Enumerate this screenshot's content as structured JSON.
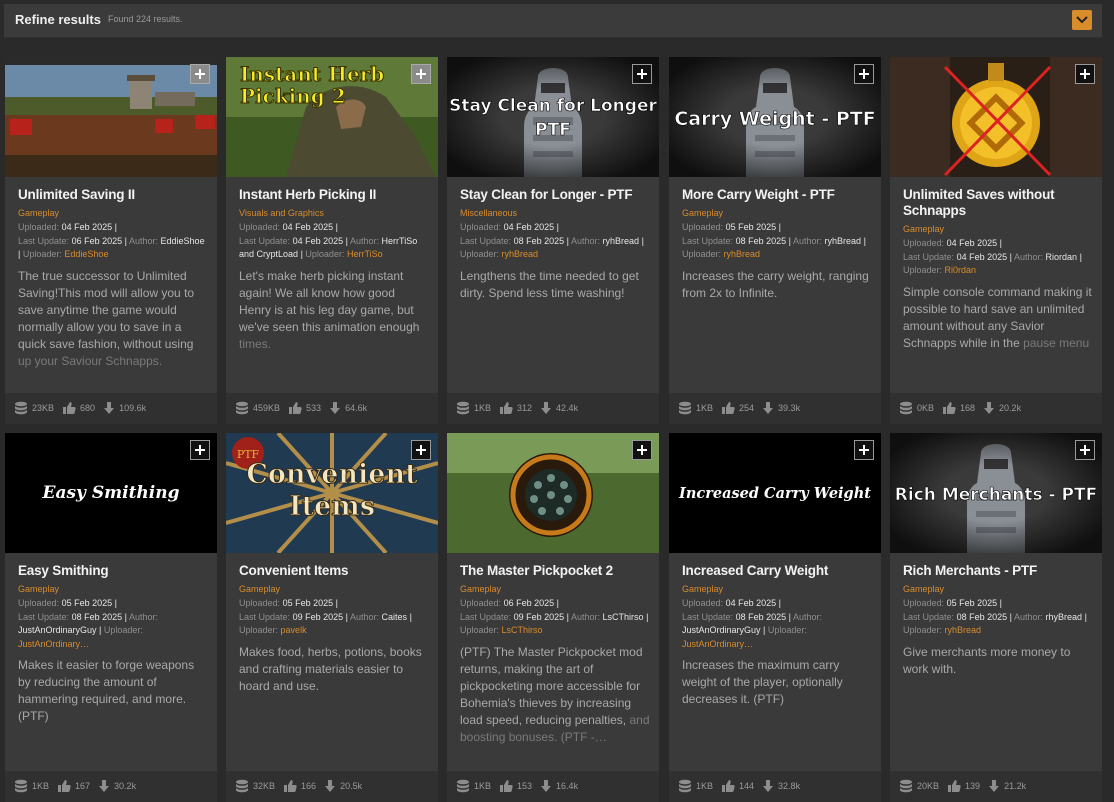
{
  "header": {
    "title": "Refine results",
    "found": "Found 224 results."
  },
  "labels": {
    "uploaded": "Uploaded:",
    "last_update": "Last Update:",
    "author": "Author:",
    "uploader": "Uploader:",
    "sep": "|"
  },
  "thumb_text": {
    "m2": [
      "Instant Herb",
      "Picking 2"
    ],
    "m3": [
      "Stay Clean for Longer",
      "PTF"
    ],
    "m4": "Carry Weight - PTF",
    "m6": "Easy Smithing",
    "m7": [
      "Convenient",
      "Items"
    ],
    "m7_seal": "PTF",
    "m9": "Increased Carry Weight",
    "m10": "Rich Merchants - PTF"
  },
  "mods": [
    {
      "title": "Unlimited Saving II",
      "category": "Gameplay",
      "uploaded": "04 Feb 2025",
      "updated": "06 Feb 2025",
      "author": "EddieShoe",
      "uploader": "EddieShoe",
      "desc": "The true successor to Unlimited Saving!This mod will allow you to save anytime the game would normally allow you to save in a quick save fashion, without using",
      "desc_fade": "up your Saviour Schnapps.",
      "size": "23KB",
      "endorsements": "680",
      "downloads": "109.6k"
    },
    {
      "title": "Instant Herb Picking II",
      "category": "Visuals and Graphics",
      "uploaded": "04 Feb 2025",
      "updated": "04 Feb 2025",
      "author": "HerrTiSo and CryptLoad",
      "uploader": "HerrTiSo",
      "desc": "Let's make herb picking instant again! We all know how good Henry is at his leg day game, but we've seen this animation enough",
      "desc_fade": "times.",
      "size": "459KB",
      "endorsements": "533",
      "downloads": "64.6k"
    },
    {
      "title": "Stay Clean for Longer - PTF",
      "category": "Miscellaneous",
      "uploaded": "04 Feb 2025",
      "updated": "08 Feb 2025",
      "author": "ryhBread",
      "uploader": "ryhBread",
      "desc": "Lengthens the time needed to get dirty. Spend less time washing!",
      "desc_fade": "",
      "size": "1KB",
      "endorsements": "312",
      "downloads": "42.4k"
    },
    {
      "title": "More Carry Weight - PTF",
      "category": "Gameplay",
      "uploaded": "05 Feb 2025",
      "updated": "08 Feb 2025",
      "author": "ryhBread",
      "uploader": "ryhBread",
      "desc": "Increases the carry weight, ranging from 2x to Infinite.",
      "desc_fade": "",
      "size": "1KB",
      "endorsements": "254",
      "downloads": "39.3k"
    },
    {
      "title": "Unlimited Saves without Schnapps",
      "category": "Gameplay",
      "uploaded": "04 Feb 2025",
      "updated": "04 Feb 2025",
      "author": "Riordan",
      "uploader": "Ri0rdan",
      "desc": "Simple console command making it possible to hard save an unlimited amount without any Savior Schnapps while in the",
      "desc_fade": "pause menu",
      "size": "0KB",
      "endorsements": "168",
      "downloads": "20.2k"
    },
    {
      "title": "Easy Smithing",
      "category": "Gameplay",
      "uploaded": "05 Feb 2025",
      "updated": "08 Feb 2025",
      "author": "JustAnOrdinaryGuy",
      "uploader": "JustAnOrdinary…",
      "desc": "Makes it easier to forge weapons by reducing the amount of hammering required, and more. (PTF)",
      "desc_fade": "",
      "size": "1KB",
      "endorsements": "167",
      "downloads": "30.2k"
    },
    {
      "title": "Convenient Items",
      "category": "Gameplay",
      "uploaded": "05 Feb 2025",
      "updated": "09 Feb 2025",
      "author": "Caites",
      "uploader": "pavelk",
      "desc": "Makes food, herbs, potions, books and crafting materials easier to hoard and use.",
      "desc_fade": "",
      "size": "32KB",
      "endorsements": "166",
      "downloads": "20.5k"
    },
    {
      "title": "The Master Pickpocket 2",
      "category": "Gameplay",
      "uploaded": "06 Feb 2025",
      "updated": "09 Feb 2025",
      "author": "LsCThirso",
      "uploader": "LsCThirso",
      "desc": "(PTF) The Master Pickpocket mod returns, making the art of pickpocketing more accessible for Bohemia's thieves by increasing load speed, reducing penalties,",
      "desc_fade": "and boosting bonuses. (PTF -…",
      "size": "1KB",
      "endorsements": "153",
      "downloads": "16.4k"
    },
    {
      "title": "Increased Carry Weight",
      "category": "Gameplay",
      "uploaded": "04 Feb 2025",
      "updated": "08 Feb 2025",
      "author": "JustAnOrdinaryGuy",
      "uploader": "JustAnOrdinary…",
      "desc": "Increases the maximum carry weight of the player, optionally decreases it. (PTF)",
      "desc_fade": "",
      "size": "1KB",
      "endorsements": "144",
      "downloads": "32.8k"
    },
    {
      "title": "Rich Merchants - PTF",
      "category": "Gameplay",
      "uploaded": "05 Feb 2025",
      "updated": "08 Feb 2025",
      "author": "rhyBread",
      "uploader": "ryhBread",
      "desc": "Give merchants more money to work with.",
      "desc_fade": "",
      "size": "20KB",
      "endorsements": "139",
      "downloads": "21.2k"
    }
  ]
}
